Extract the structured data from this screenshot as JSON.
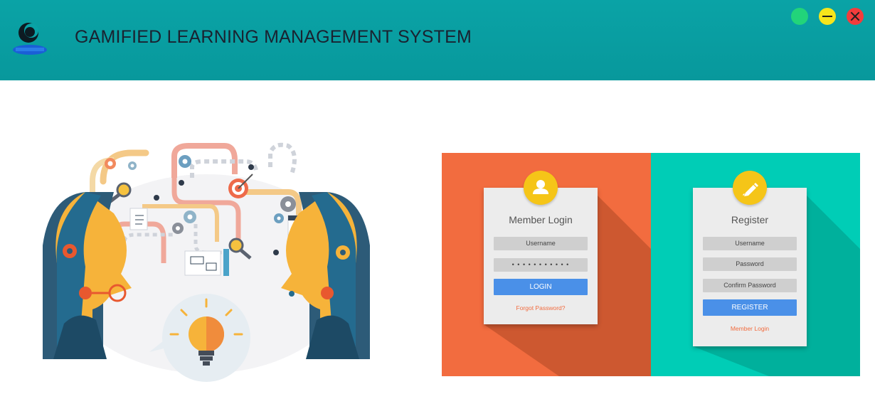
{
  "header": {
    "app_title": "GAMIFIED LEARNING MANAGEMENT SYSTEM",
    "logo_icon": "gamified-lms-logo",
    "window_controls": {
      "maximize_color": "#22d47a",
      "minimize_color": "#f7e51b",
      "close_color": "#f23c3c"
    }
  },
  "illustration": {
    "icon": "two-heads-brainstorm-lightbulb"
  },
  "login_card": {
    "title": "Member Login",
    "badge_icon": "user-icon",
    "username_placeholder": "Username",
    "password_value": "• • • • • • • • • • •",
    "button_label": "LOGIN",
    "forgot_link": "Forgot Password?"
  },
  "register_card": {
    "title": "Register",
    "badge_icon": "pencil-icon",
    "username_placeholder": "Username",
    "password_placeholder": "Password",
    "confirm_placeholder": "Confirm Password",
    "button_label": "REGISTER",
    "member_login_link": "Member Login"
  },
  "colors": {
    "header": "#0aa3a6",
    "login_panel": "#f26c3f",
    "register_panel": "#00cdb6",
    "button": "#4a90e8",
    "badge": "#f5c518"
  }
}
